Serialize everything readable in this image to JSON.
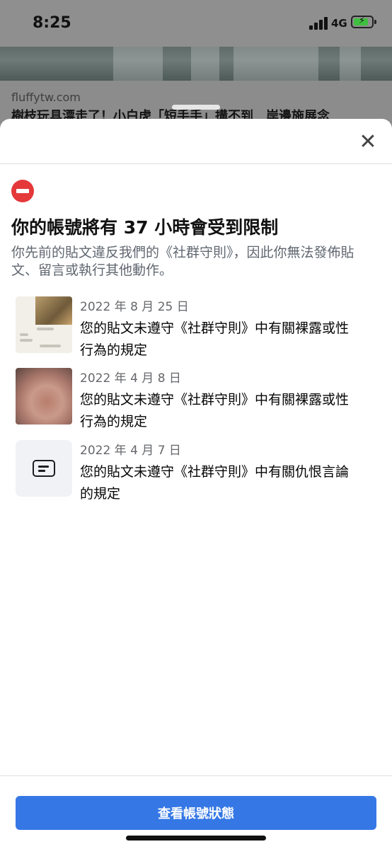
{
  "status_bar": {
    "time": "8:25",
    "network": "4G"
  },
  "background_post": {
    "domain": "fluffytw.com",
    "headline": "樹枝玩具漂走了！小白虎「短手手」搆不到　岸邊施展念"
  },
  "sheet": {
    "title": "你的帳號將有 37 小時會受到限制",
    "subtitle": "你先前的貼文違反我們的《社群守則》，因此你無法發佈貼文、留言或執行其他動作。",
    "violations": [
      {
        "date": "2022 年 8 月 25 日",
        "text": "您的貼文未遵守《社群守則》中有關裸露或性行為的規定",
        "thumbnail": "chat-screenshot"
      },
      {
        "date": "2022 年 4 月 8 日",
        "text": "您的貼文未遵守《社群守則》中有關裸露或性行為的規定",
        "thumbnail": "photo"
      },
      {
        "date": "2022 年 4 月 7 日",
        "text": "您的貼文未遵守《社群守則》中有關仇恨言論的規定",
        "thumbnail": "message-icon"
      }
    ],
    "button_label": "查看帳號狀態"
  },
  "colors": {
    "accent": "#3578e5",
    "warning": "#e4383a"
  },
  "icons": {
    "close": "close-icon",
    "warning": "stop-icon",
    "text_post": "message-icon"
  }
}
